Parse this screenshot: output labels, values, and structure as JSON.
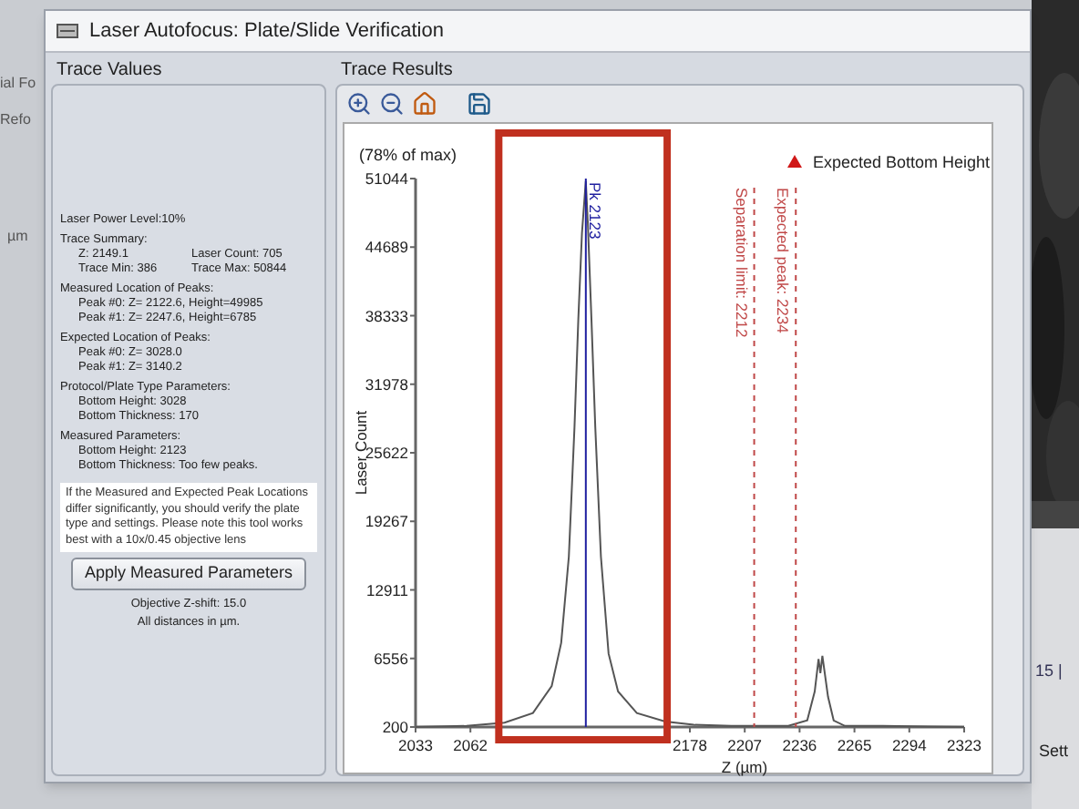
{
  "background_app": {
    "left_texts": [
      "ial Fo",
      "Refo",
      "µm"
    ],
    "right_texts": [
      "15 |",
      "Sett"
    ],
    "photo": {
      "kind": "picture"
    }
  },
  "window": {
    "title": "Laser Autofocus: Plate/Slide Verification"
  },
  "trace_values": {
    "title": "Trace Values",
    "lines": [
      {
        "text": "Laser Power Level:10%"
      },
      {
        "text": "Trace Summary:",
        "children": [
          {
            "columns": [
              "Z: 2149.1",
              "Laser Count: 705"
            ]
          },
          {
            "columns": [
              "Trace Min: 386",
              "Trace Max: 50844"
            ]
          }
        ]
      },
      {
        "text": "Measured Location of Peaks:",
        "children": [
          {
            "columns": [
              "Peak #0: Z= 2122.6, Height=49985"
            ]
          },
          {
            "columns": [
              "Peak #1: Z= 2247.6, Height=6785"
            ]
          }
        ]
      },
      {
        "text": "Expected Location of Peaks:",
        "children": [
          {
            "columns": [
              "Peak #0: Z= 3028.0"
            ]
          },
          {
            "columns": [
              "Peak #1: Z= 3140.2"
            ]
          }
        ]
      },
      {
        "text": "Protocol/Plate Type Parameters:",
        "children": [
          {
            "columns": [
              "Bottom Height: 3028"
            ]
          },
          {
            "columns": [
              "Bottom Thickness: 170"
            ]
          }
        ]
      },
      {
        "text": "Measured Parameters:",
        "children": [
          {
            "columns": [
              "Bottom Height: 2123"
            ]
          },
          {
            "columns": [
              "Bottom Thickness: Too few peaks."
            ]
          }
        ]
      }
    ],
    "note": "If the Measured and Expected Peak Locations differ significantly, you should verify the plate type and settings. Please note this tool works best with a 10x/0.45 objective lens",
    "apply_button": "Apply Measured Parameters",
    "footer": [
      "Objective Z-shift: 15.0",
      "All distances in µm."
    ]
  },
  "trace_results": {
    "title": "Trace Results",
    "toolbar": [
      {
        "kind": "zoom_in"
      },
      {
        "kind": "zoom_out"
      },
      {
        "kind": "home"
      },
      {
        "kind": "save"
      }
    ],
    "scale_note": "(78% of max)",
    "legend": {
      "label": "Expected Bottom Height",
      "color": "#d01818"
    },
    "chart_data": {
      "type": "line",
      "xlabel": "Z (µm)",
      "ylabel": "Laser Count",
      "x": [
        2033,
        2060,
        2080,
        2095,
        2105,
        2110,
        2114,
        2117,
        2119,
        2121,
        2123,
        2124,
        2126,
        2128,
        2131,
        2135,
        2140,
        2150,
        2165,
        2180,
        2200,
        2230,
        2240,
        2244,
        2246,
        2247,
        2248,
        2251,
        2254,
        2260,
        2280,
        2323
      ],
      "series": [
        {
          "color": "#555555",
          "values": [
            200,
            300,
            600,
            1500,
            4000,
            8000,
            16000,
            28000,
            38000,
            46000,
            50800,
            47000,
            38000,
            28000,
            16000,
            7000,
            3500,
            1500,
            700,
            400,
            300,
            300,
            800,
            3500,
            6500,
            5200,
            6800,
            3000,
            800,
            300,
            300,
            200
          ]
        }
      ],
      "xlim": [
        2033,
        2323
      ],
      "ylim": [
        200,
        51044
      ],
      "xticks": [
        2033,
        2062,
        2178,
        2207,
        2236,
        2265,
        2294,
        2323
      ],
      "yticks": [
        200,
        6556,
        12911,
        19267,
        25622,
        31978,
        38333,
        44689,
        51044
      ],
      "ref_lines": [
        {
          "axis": "x",
          "value": 2123,
          "label": "Pk 2123",
          "color": "#2020a0"
        },
        {
          "axis": "x",
          "value": 2212,
          "label": "Separation limit: 2212",
          "color": "#c04848"
        },
        {
          "axis": "x",
          "value": 2234,
          "label": "Expected peak: 2234",
          "color": "#c04848"
        }
      ]
    }
  }
}
